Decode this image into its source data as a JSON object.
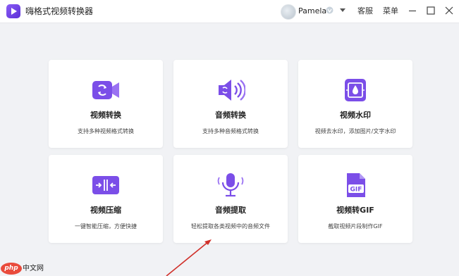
{
  "app": {
    "title": "嗨格式视频转换器"
  },
  "header": {
    "username": "Pamela",
    "menu": [
      "客服",
      "菜单"
    ]
  },
  "cards": [
    {
      "title": "视频转换",
      "desc": "支持多种视频格式转换",
      "icon": "video-convert-icon"
    },
    {
      "title": "音频转换",
      "desc": "支持多种音频格式转换",
      "icon": "audio-convert-icon"
    },
    {
      "title": "视频水印",
      "desc": "视频去水印，添加图片/文字水印",
      "icon": "video-watermark-icon"
    },
    {
      "title": "视频压缩",
      "desc": "一键智能压缩，方便快捷",
      "icon": "video-compress-icon"
    },
    {
      "title": "音频提取",
      "desc": "轻松提取各类视频中的音频文件",
      "icon": "audio-extract-icon"
    },
    {
      "title": "视频转GIF",
      "desc": "截取视频片段制作GIF",
      "icon": "video-to-gif-icon"
    }
  ],
  "watermark": {
    "logo": "php",
    "text": "中文网"
  },
  "colors": {
    "accent": "#7b4ee8",
    "accent_dark": "#5b2fd6",
    "background": "#f1f2f5",
    "arrow": "#d0302a"
  }
}
